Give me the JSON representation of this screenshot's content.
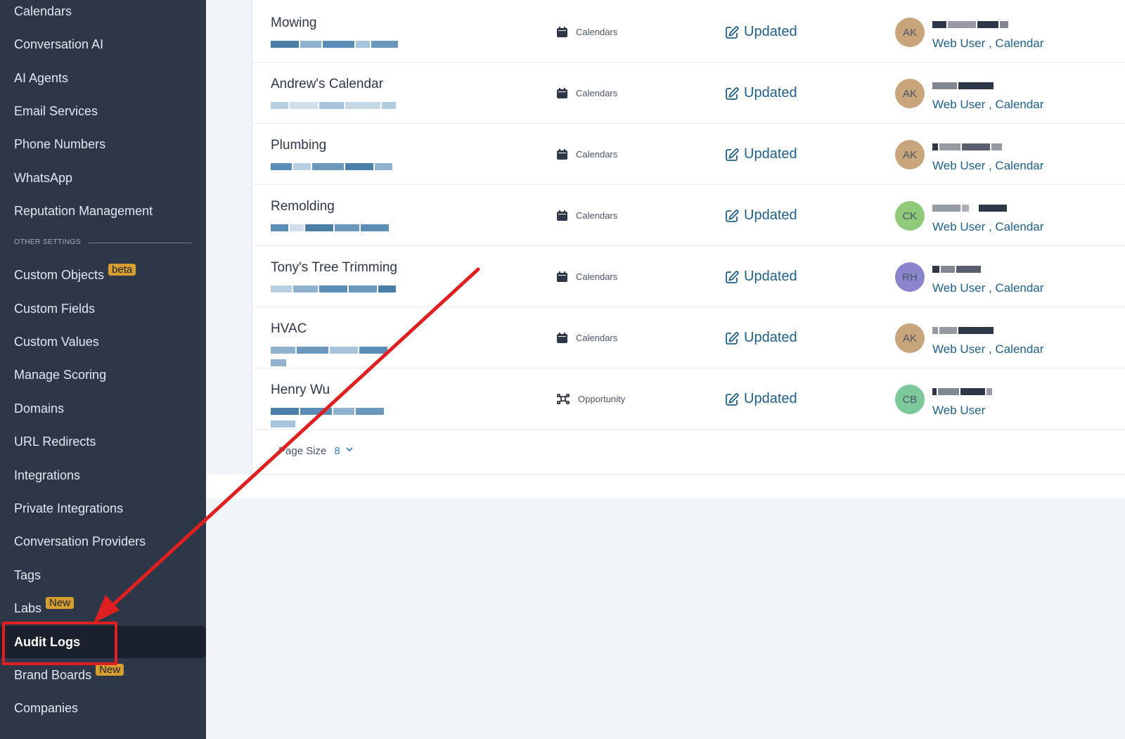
{
  "sidebar": {
    "items": [
      {
        "label": "Calendars"
      },
      {
        "label": "Conversation AI"
      },
      {
        "label": "AI Agents"
      },
      {
        "label": "Email Services"
      },
      {
        "label": "Phone Numbers"
      },
      {
        "label": "WhatsApp"
      },
      {
        "label": "Reputation Management"
      }
    ],
    "section_label": "OTHER SETTINGS",
    "other_items": [
      {
        "label": "Custom Objects",
        "badge": "beta"
      },
      {
        "label": "Custom Fields"
      },
      {
        "label": "Custom Values"
      },
      {
        "label": "Manage Scoring"
      },
      {
        "label": "Domains"
      },
      {
        "label": "URL Redirects"
      },
      {
        "label": "Integrations"
      },
      {
        "label": "Private Integrations"
      },
      {
        "label": "Conversation Providers"
      },
      {
        "label": "Tags"
      },
      {
        "label": "Labs",
        "badge": "New"
      },
      {
        "label": "Audit Logs",
        "active": true
      },
      {
        "label": "Brand Boards",
        "badge": "New"
      },
      {
        "label": "Companies"
      }
    ]
  },
  "table": {
    "rows": [
      {
        "title": "Mowing",
        "module": "Calendars",
        "module_icon": "calendar-icon",
        "action": "Updated",
        "initials": "AK",
        "avatar_color": "#c9a57b",
        "roles": "Web User , Calendar"
      },
      {
        "title": "Andrew's Calendar",
        "module": "Calendars",
        "module_icon": "calendar-icon",
        "action": "Updated",
        "initials": "AK",
        "avatar_color": "#c9a57b",
        "roles": "Web User , Calendar"
      },
      {
        "title": "Plumbing",
        "module": "Calendars",
        "module_icon": "calendar-icon",
        "action": "Updated",
        "initials": "AK",
        "avatar_color": "#c9a57b",
        "roles": "Web User , Calendar"
      },
      {
        "title": "Remolding",
        "module": "Calendars",
        "module_icon": "calendar-icon",
        "action": "Updated",
        "initials": "CK",
        "avatar_color": "#8fc97a",
        "roles": "Web User , Calendar"
      },
      {
        "title": "Tony's Tree Trimming",
        "module": "Calendars",
        "module_icon": "calendar-icon",
        "action": "Updated",
        "initials": "RH",
        "avatar_color": "#8a85cc",
        "roles": "Web User , Calendar"
      },
      {
        "title": "HVAC",
        "module": "Calendars",
        "module_icon": "calendar-icon",
        "action": "Updated",
        "initials": "AK",
        "avatar_color": "#c9a57b",
        "roles": "Web User , Calendar"
      },
      {
        "title": "Henry Wu",
        "module": "Opportunity",
        "module_icon": "opportunity-icon",
        "action": "Updated",
        "initials": "CB",
        "avatar_color": "#7bc99a",
        "roles": "Web User"
      }
    ]
  },
  "pager": {
    "label": "Page Size",
    "value": "8"
  },
  "colors": {
    "sidebar_bg": "#2d3748",
    "sidebar_active_bg": "#1a202c",
    "badge": "#d69e2e",
    "link": "#1e5f8a",
    "annotation_red": "#e02020"
  }
}
